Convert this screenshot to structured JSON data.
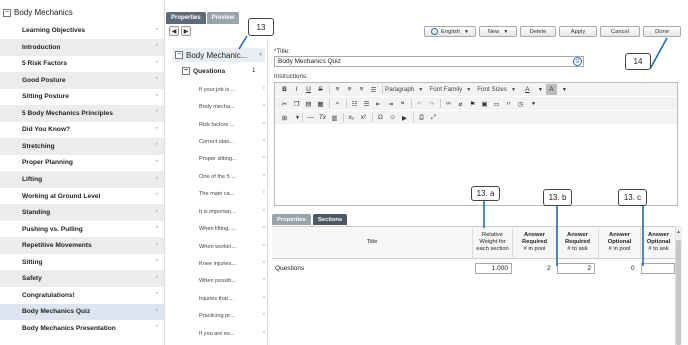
{
  "course_tree": {
    "root_label": "Body Mechanics",
    "items": [
      {
        "label": "Learning Objectives"
      },
      {
        "label": "Introduction"
      },
      {
        "label": "5 Risk Factors"
      },
      {
        "label": "Good Posture"
      },
      {
        "label": "Sitting Posture"
      },
      {
        "label": "5 Body Mechanics Principles"
      },
      {
        "label": "Did You Know?"
      },
      {
        "label": "Stretching"
      },
      {
        "label": "Proper Planning"
      },
      {
        "label": "Lifting"
      },
      {
        "label": "Working at Ground Level"
      },
      {
        "label": "Standing"
      },
      {
        "label": "Pushing vs. Pulling"
      },
      {
        "label": "Repetitive Movements"
      },
      {
        "label": "Sitting"
      },
      {
        "label": "Safety"
      },
      {
        "label": "Congratulations!"
      },
      {
        "label": "Body Mechanics Quiz"
      },
      {
        "label": "Body Mechanics Presentation"
      }
    ],
    "selected_index": 17,
    "item_marker": "*"
  },
  "panel_tabs": {
    "properties": "Properties",
    "preview": "Preview"
  },
  "middle": {
    "node_label": "Body Mechanic...",
    "questions_label": "Questions",
    "questions_count": "1",
    "questions": [
      "If your job is ...",
      "Body mecha...",
      "Risk factors ...",
      "Correct stan...",
      "Proper sitting...",
      "One of the 5 ...",
      "The main ca...",
      "It is importan...",
      "When lifting, ...",
      "When workin...",
      "Knee injuries...",
      "When possib...",
      "Injuries that ...",
      "Practicing pr...",
      "If you are ex..."
    ]
  },
  "toolbar": {
    "language": "English",
    "new": "New",
    "delete": "Delete",
    "apply": "Apply",
    "cancel": "Cancel",
    "done": "Done"
  },
  "form": {
    "title_label": "*Title:",
    "title_value": "Body Mechanics Quiz",
    "instructions_label": "Instructions:",
    "paragraph": "Paragraph",
    "font_family": "Font Family",
    "font_sizes": "Font Sizes"
  },
  "bottom_tabs": {
    "properties": "Properties",
    "sections": "Sections"
  },
  "table": {
    "headers": {
      "title": "Title",
      "relative_weight": "Relative Weight for each section",
      "ans_req_pool_1": "Answer Required",
      "ans_req_pool_2": "# in pool",
      "ans_req_ask_1": "Answer Required",
      "ans_req_ask_2": "# to ask",
      "ans_opt_pool_1": "Answer Optional",
      "ans_opt_pool_2": "# in pool",
      "ans_opt_ask_1": "Answer Optional",
      "ans_opt_ask_2": "# to ask"
    },
    "row": {
      "title": "Questions",
      "weight": "1.000",
      "req_pool": "2",
      "req_ask": "2",
      "opt_pool": "0",
      "opt_ask": ""
    }
  },
  "callouts": {
    "c13": "13",
    "c14": "14",
    "c13a": "13. a",
    "c13b": "13. b",
    "c13c": "13. c"
  },
  "colors": {
    "accent_tab": "#5d6b78",
    "selected_row": "#dde6f0",
    "callout_line": "#1f6fb2"
  }
}
